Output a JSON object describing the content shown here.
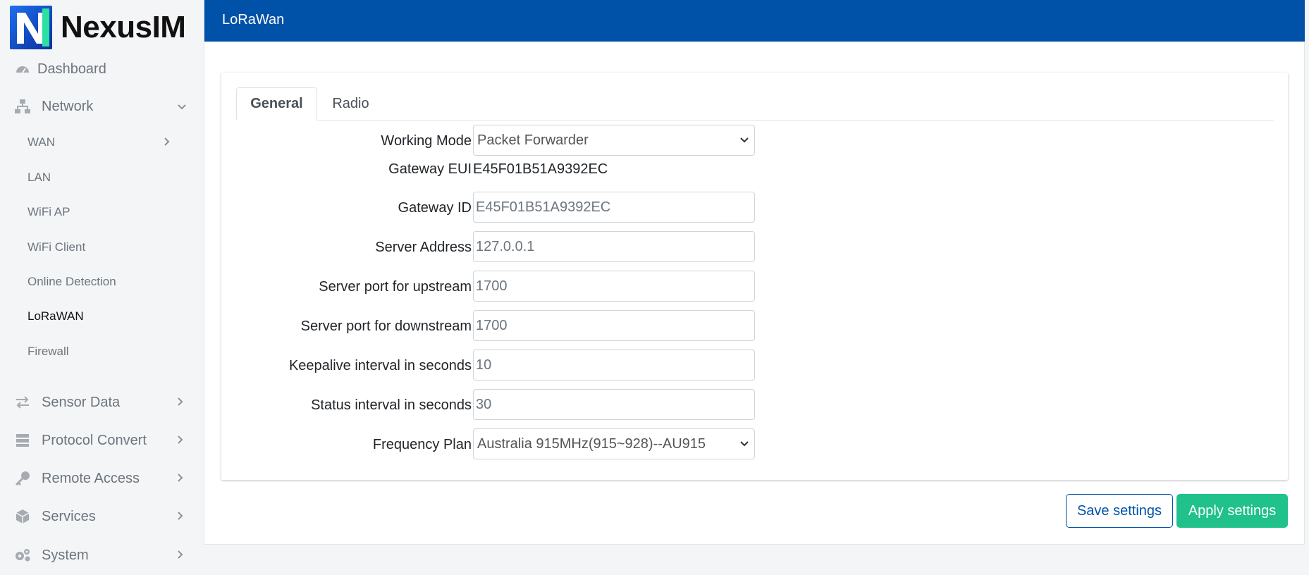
{
  "brand": {
    "name": "NexusIM"
  },
  "sidebar": {
    "items": [
      {
        "label": "Dashboard",
        "icon": "dashboard-icon"
      },
      {
        "label": "Network",
        "icon": "network-icon",
        "expanded": true
      },
      {
        "label": "Sensor Data",
        "icon": "sensor-data-icon"
      },
      {
        "label": "Protocol Convert",
        "icon": "protocol-convert-icon"
      },
      {
        "label": "Remote Access",
        "icon": "key-icon"
      },
      {
        "label": "Services",
        "icon": "services-icon"
      },
      {
        "label": "System",
        "icon": "system-gears-icon"
      }
    ],
    "network_sub": [
      {
        "label": "WAN"
      },
      {
        "label": "LAN"
      },
      {
        "label": "WiFi AP"
      },
      {
        "label": "WiFi Client"
      },
      {
        "label": "Online Detection"
      },
      {
        "label": "LoRaWAN",
        "active": true
      },
      {
        "label": "Firewall"
      }
    ]
  },
  "header": {
    "title": "LoRaWan"
  },
  "tabs": [
    {
      "label": "General",
      "active": true
    },
    {
      "label": "Radio"
    }
  ],
  "form": {
    "working_mode": {
      "label": "Working Mode",
      "value": "Packet Forwarder"
    },
    "gateway_eui": {
      "label": "Gateway EUI",
      "value": "E45F01B51A9392EC"
    },
    "gateway_id": {
      "label": "Gateway ID",
      "placeholder": "E45F01B51A9392EC"
    },
    "server_address": {
      "label": "Server Address",
      "placeholder": "127.0.0.1"
    },
    "port_up": {
      "label": "Server port for upstream",
      "placeholder": "1700"
    },
    "port_down": {
      "label": "Server port for downstream",
      "placeholder": "1700"
    },
    "keepalive": {
      "label": "Keepalive interval in seconds",
      "placeholder": "10"
    },
    "status_interval": {
      "label": "Status interval in seconds",
      "placeholder": "30"
    },
    "frequency_plan": {
      "label": "Frequency Plan",
      "value": "Australia 915MHz(915~928)--AU915"
    }
  },
  "actions": {
    "save": "Save settings",
    "apply": "Apply settings"
  },
  "colors": {
    "header": "#0052a8",
    "apply": "#20c18a"
  }
}
